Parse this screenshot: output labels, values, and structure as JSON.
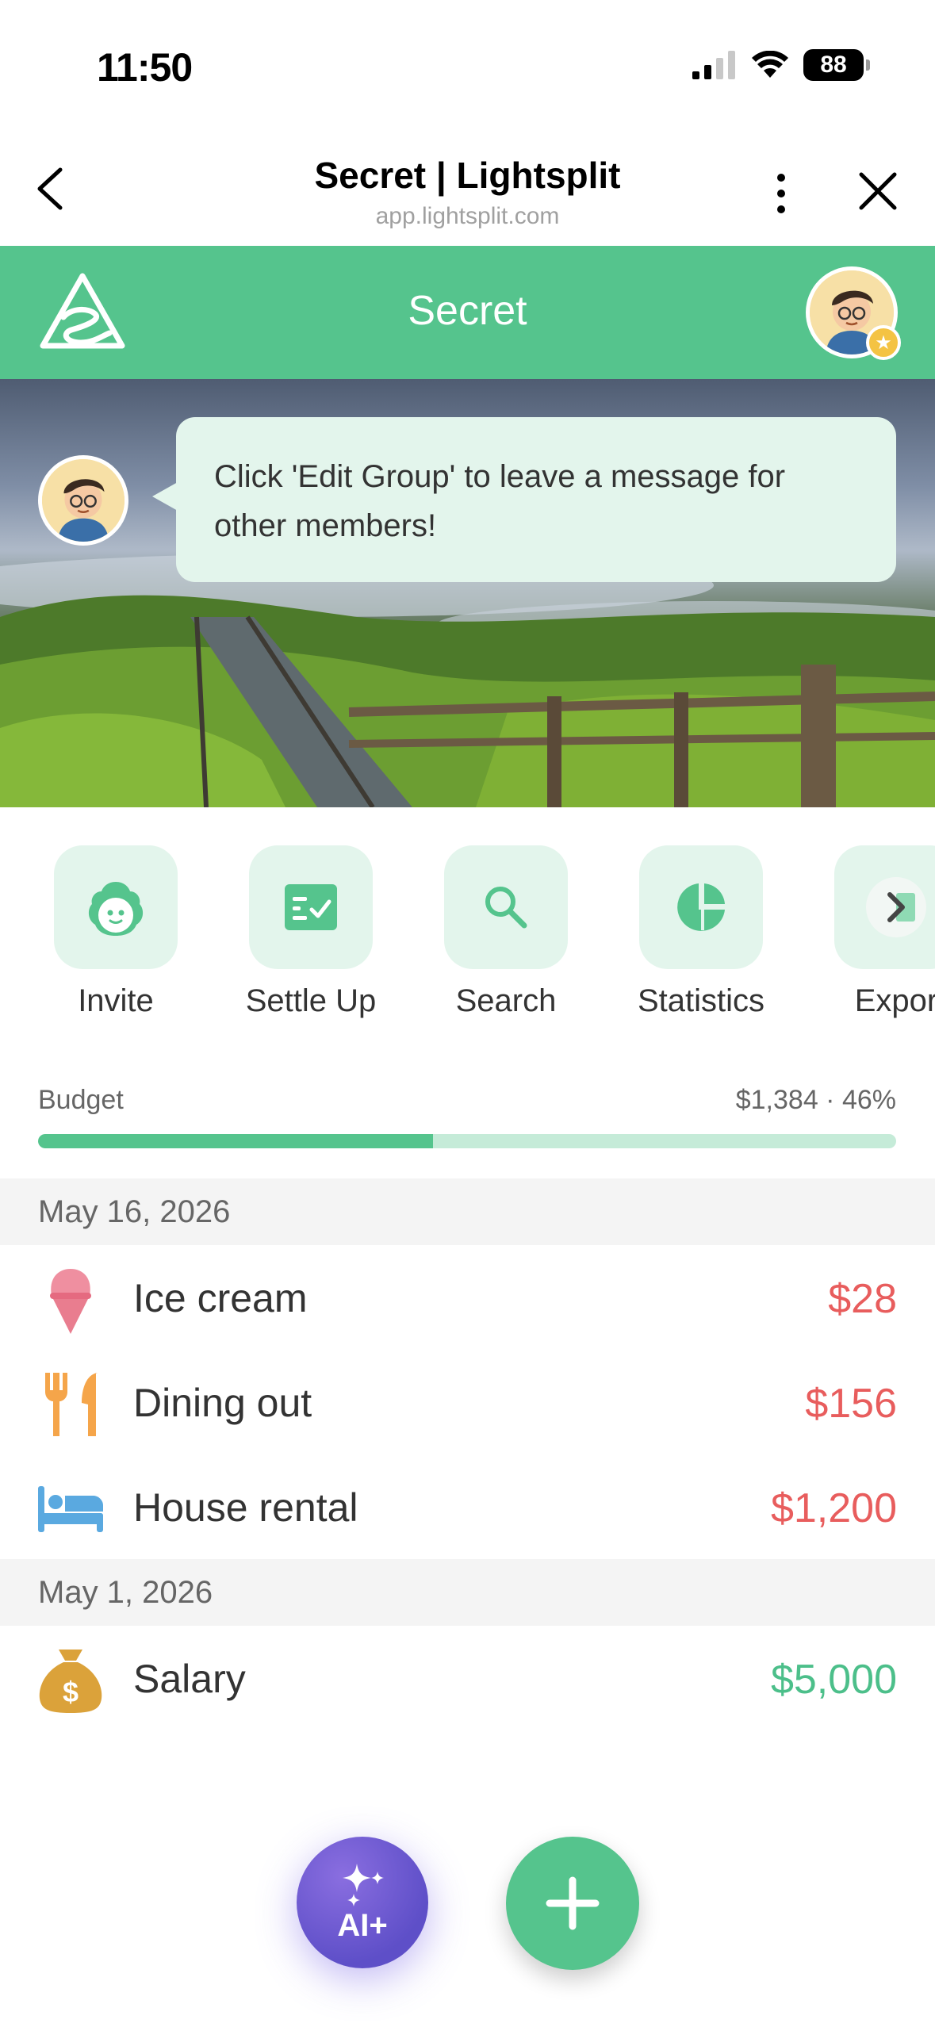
{
  "status_bar": {
    "time": "11:50",
    "battery": "88"
  },
  "browser": {
    "title": "Secret | Lightsplit",
    "url": "app.lightsplit.com"
  },
  "header": {
    "title": "Secret"
  },
  "banner": {
    "message": "Click 'Edit Group' to leave a message for other members!"
  },
  "actions": [
    {
      "label": "Invite",
      "icon": "face-icon"
    },
    {
      "label": "Settle Up",
      "icon": "checklist-icon"
    },
    {
      "label": "Search",
      "icon": "search-icon"
    },
    {
      "label": "Statistics",
      "icon": "pie-chart-icon"
    },
    {
      "label": "Expor",
      "icon": "chevron-right-icon"
    }
  ],
  "budget": {
    "label": "Budget",
    "value": "$1,384 · 46%",
    "progress": 0.46
  },
  "groups": [
    {
      "date": "May 16, 2026",
      "items": [
        {
          "name": "Ice cream",
          "amount": "$28",
          "icon": "ice-cream-icon",
          "type": "expense"
        },
        {
          "name": "Dining out",
          "amount": "$156",
          "icon": "utensils-icon",
          "type": "expense"
        },
        {
          "name": "House rental",
          "amount": "$1,200",
          "icon": "bed-icon",
          "type": "expense"
        }
      ]
    },
    {
      "date": "May 1, 2026",
      "items": [
        {
          "name": "Salary",
          "amount": "$5,000",
          "icon": "money-bag-icon",
          "type": "income"
        }
      ]
    }
  ],
  "fab": {
    "ai_label": "AI+"
  },
  "colors": {
    "brand": "#55c48d",
    "expense": "#e85d5d",
    "income": "#4cbf8a",
    "ai": "#5e4fc8"
  }
}
